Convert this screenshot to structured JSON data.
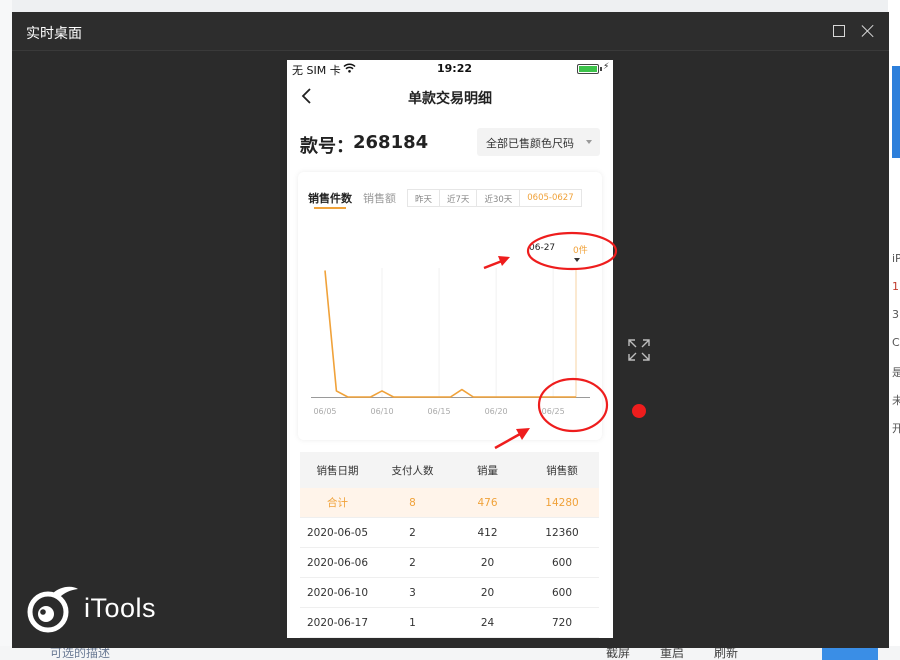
{
  "window": {
    "title": "实时桌面"
  },
  "brand": {
    "name": "iTools"
  },
  "background": {
    "bottom_text": "可选的描述",
    "toolbar": [
      "截屏",
      "重启",
      "刷新"
    ],
    "side_chars": [
      "iP",
      "1",
      "3",
      "C",
      "是",
      "未",
      "开"
    ]
  },
  "status_bar": {
    "carrier": "无 SIM 卡",
    "time": "19:22"
  },
  "page": {
    "title": "单款交易明细"
  },
  "product": {
    "code_label": "款号：",
    "code": "268184",
    "filter_label": "全部已售颜色尺码"
  },
  "chart_tabs": {
    "metrics": [
      "销售件数",
      "销售额"
    ],
    "active_metric": 0,
    "ranges": [
      "昨天",
      "近7天",
      "近30天",
      "0605-0627"
    ],
    "active_range": 3
  },
  "tooltip": {
    "date": "06-27",
    "value": "0件"
  },
  "colors": {
    "accent": "#f0a23a",
    "annotation": "#ee1d1d"
  },
  "chart_data": {
    "type": "line",
    "title": "",
    "xlabel": "",
    "ylabel": "",
    "x": [
      "06/05",
      "06/06",
      "06/07",
      "06/08",
      "06/09",
      "06/10",
      "06/11",
      "06/12",
      "06/13",
      "06/14",
      "06/15",
      "06/16",
      "06/17",
      "06/18",
      "06/19",
      "06/20",
      "06/21",
      "06/22",
      "06/23",
      "06/24",
      "06/25",
      "06/26",
      "06/27"
    ],
    "x_tick_labels": [
      "06/05",
      "06/10",
      "06/15",
      "06/20",
      "06/25"
    ],
    "series": [
      {
        "name": "",
        "values": [
          412,
          20,
          0,
          0,
          0,
          20,
          0,
          0,
          0,
          0,
          0,
          0,
          24,
          0,
          0,
          0,
          0,
          0,
          0,
          0,
          0,
          0,
          0
        ]
      }
    ],
    "ylim": [
      0,
      420
    ],
    "grid": "vertical",
    "highlight": "06/27"
  },
  "table": {
    "headers": [
      "销售日期",
      "支付人数",
      "销量",
      "销售额"
    ],
    "total": [
      "合计",
      "8",
      "476",
      "14280"
    ],
    "rows": [
      [
        "2020-06-05",
        "2",
        "412",
        "12360"
      ],
      [
        "2020-06-06",
        "2",
        "20",
        "600"
      ],
      [
        "2020-06-10",
        "3",
        "20",
        "600"
      ],
      [
        "2020-06-17",
        "1",
        "24",
        "720"
      ]
    ]
  }
}
